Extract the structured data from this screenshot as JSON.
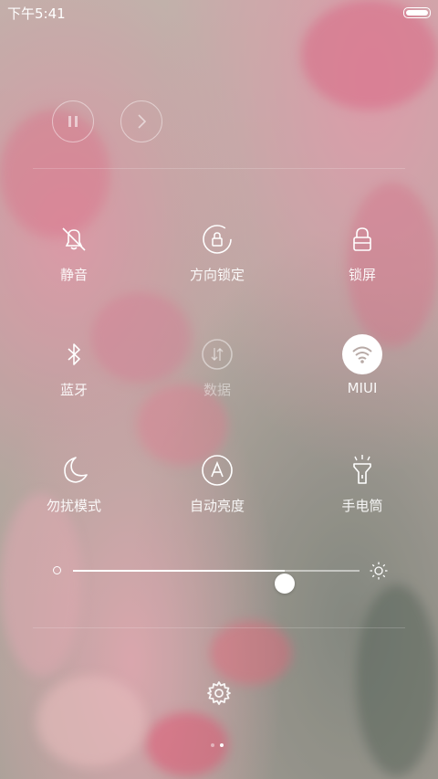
{
  "status_bar": {
    "time": "下午5:41",
    "battery_icon": "battery-icon"
  },
  "media": {
    "pause_icon": "pause-icon",
    "next_icon": "chevron-right-icon"
  },
  "toggles": [
    {
      "id": "mute",
      "label": "静音",
      "icon": "bell-off-icon",
      "state": "off"
    },
    {
      "id": "rotation-lock",
      "label": "方向锁定",
      "icon": "rotation-lock-icon",
      "state": "off"
    },
    {
      "id": "lock-screen",
      "label": "锁屏",
      "icon": "lock-icon",
      "state": "off"
    },
    {
      "id": "bluetooth",
      "label": "蓝牙",
      "icon": "bluetooth-icon",
      "state": "off"
    },
    {
      "id": "data",
      "label": "数据",
      "icon": "mobile-data-icon",
      "state": "disabled"
    },
    {
      "id": "wifi",
      "label": "MIUI",
      "icon": "wifi-icon",
      "state": "on"
    },
    {
      "id": "dnd",
      "label": "勿扰模式",
      "icon": "moon-icon",
      "state": "off"
    },
    {
      "id": "auto-brightness",
      "label": "自动亮度",
      "icon": "auto-brightness-icon",
      "state": "off"
    },
    {
      "id": "flashlight",
      "label": "手电筒",
      "icon": "flashlight-icon",
      "state": "off"
    }
  ],
  "brightness": {
    "level": 0.74,
    "min_icon": "brightness-low-icon",
    "max_icon": "sun-icon"
  },
  "settings": {
    "icon": "gear-icon"
  },
  "pager": {
    "count": 2,
    "active_index": 1
  },
  "colors": {
    "active_tile_bg": "#ffffff",
    "wifi_glyph": "#b8aaa6"
  }
}
